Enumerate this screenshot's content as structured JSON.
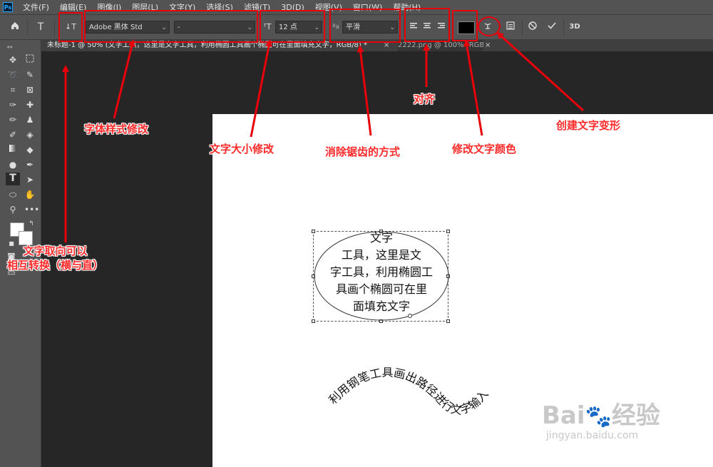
{
  "menubar": {
    "logo": "Ps",
    "items": [
      "文件(F)",
      "编辑(E)",
      "图像(I)",
      "图层(L)",
      "文字(Y)",
      "选择(S)",
      "滤镜(T)",
      "3D(D)",
      "视图(V)",
      "窗口(W)",
      "帮助(H)"
    ]
  },
  "options": {
    "font_family": "Adobe 黑体 Std",
    "font_style": "-",
    "font_size": "12 点",
    "aa_label": "ªa",
    "antialias": "平滑",
    "three_d": "3D",
    "text_color": "#000000"
  },
  "tabs": [
    {
      "label": "未标题-1 @ 50% (文字工具，这里是文字工具，利用椭圆工具画个椭圆可在里面填充文字，RGB/8) *",
      "close": "×"
    },
    {
      "label": "2222.png @ 100% (RGB/8) *",
      "close": "×"
    }
  ],
  "annotations": {
    "orientation": "文字取向可以\n相互转换（横与直）",
    "font_style": "字体样式修改",
    "font_size": "文字大小修改",
    "antialias": "消除锯齿的方式",
    "align": "对齐",
    "color": "修改文字颜色",
    "warp": "创建文字变形"
  },
  "canvas": {
    "ellipse_lines": [
      "文字",
      "工具，这里是文",
      "字工具，利用椭圆工",
      "具画个椭圆可在里",
      "面填充文字"
    ],
    "path_text": "利用钢笔工具画出路径进行文字输入"
  },
  "watermark": {
    "brand": "Bai",
    "brand_cn": "经验",
    "url": "jingyan.baidu.com"
  }
}
